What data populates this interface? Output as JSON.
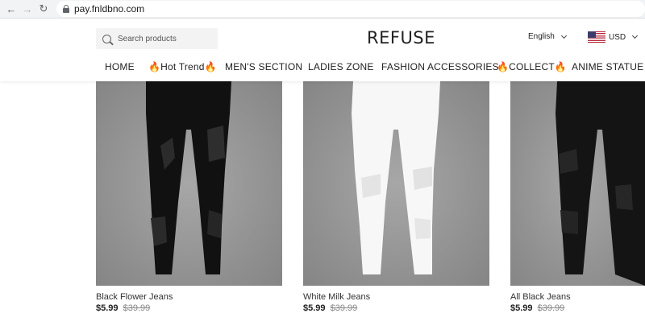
{
  "browser": {
    "url": "pay.fnldbno.com"
  },
  "header": {
    "search_placeholder": "Search products",
    "logo": "REFUSE",
    "language": "English",
    "currency": "USD"
  },
  "menu": {
    "items": [
      {
        "label": "HOME"
      },
      {
        "label": "🔥Hot Trend🔥"
      },
      {
        "label": "MEN'S SECTION"
      },
      {
        "label": "LADIES ZONE"
      },
      {
        "label": "FASHION ACCESSORIES"
      },
      {
        "label": "🔥COLLECT🔥"
      },
      {
        "label": "ANIME STATUE"
      }
    ]
  },
  "products": [
    {
      "name": "Black Flower Jeans",
      "price": "$5.99",
      "compare_price": "$39.99",
      "color": "#111111"
    },
    {
      "name": "White Milk Jeans",
      "price": "$5.99",
      "compare_price": "$39.99",
      "color": "#f7f7f7"
    },
    {
      "name": "All Black Jeans",
      "price": "$5.99",
      "compare_price": "$39.99",
      "color": "#141414"
    }
  ]
}
